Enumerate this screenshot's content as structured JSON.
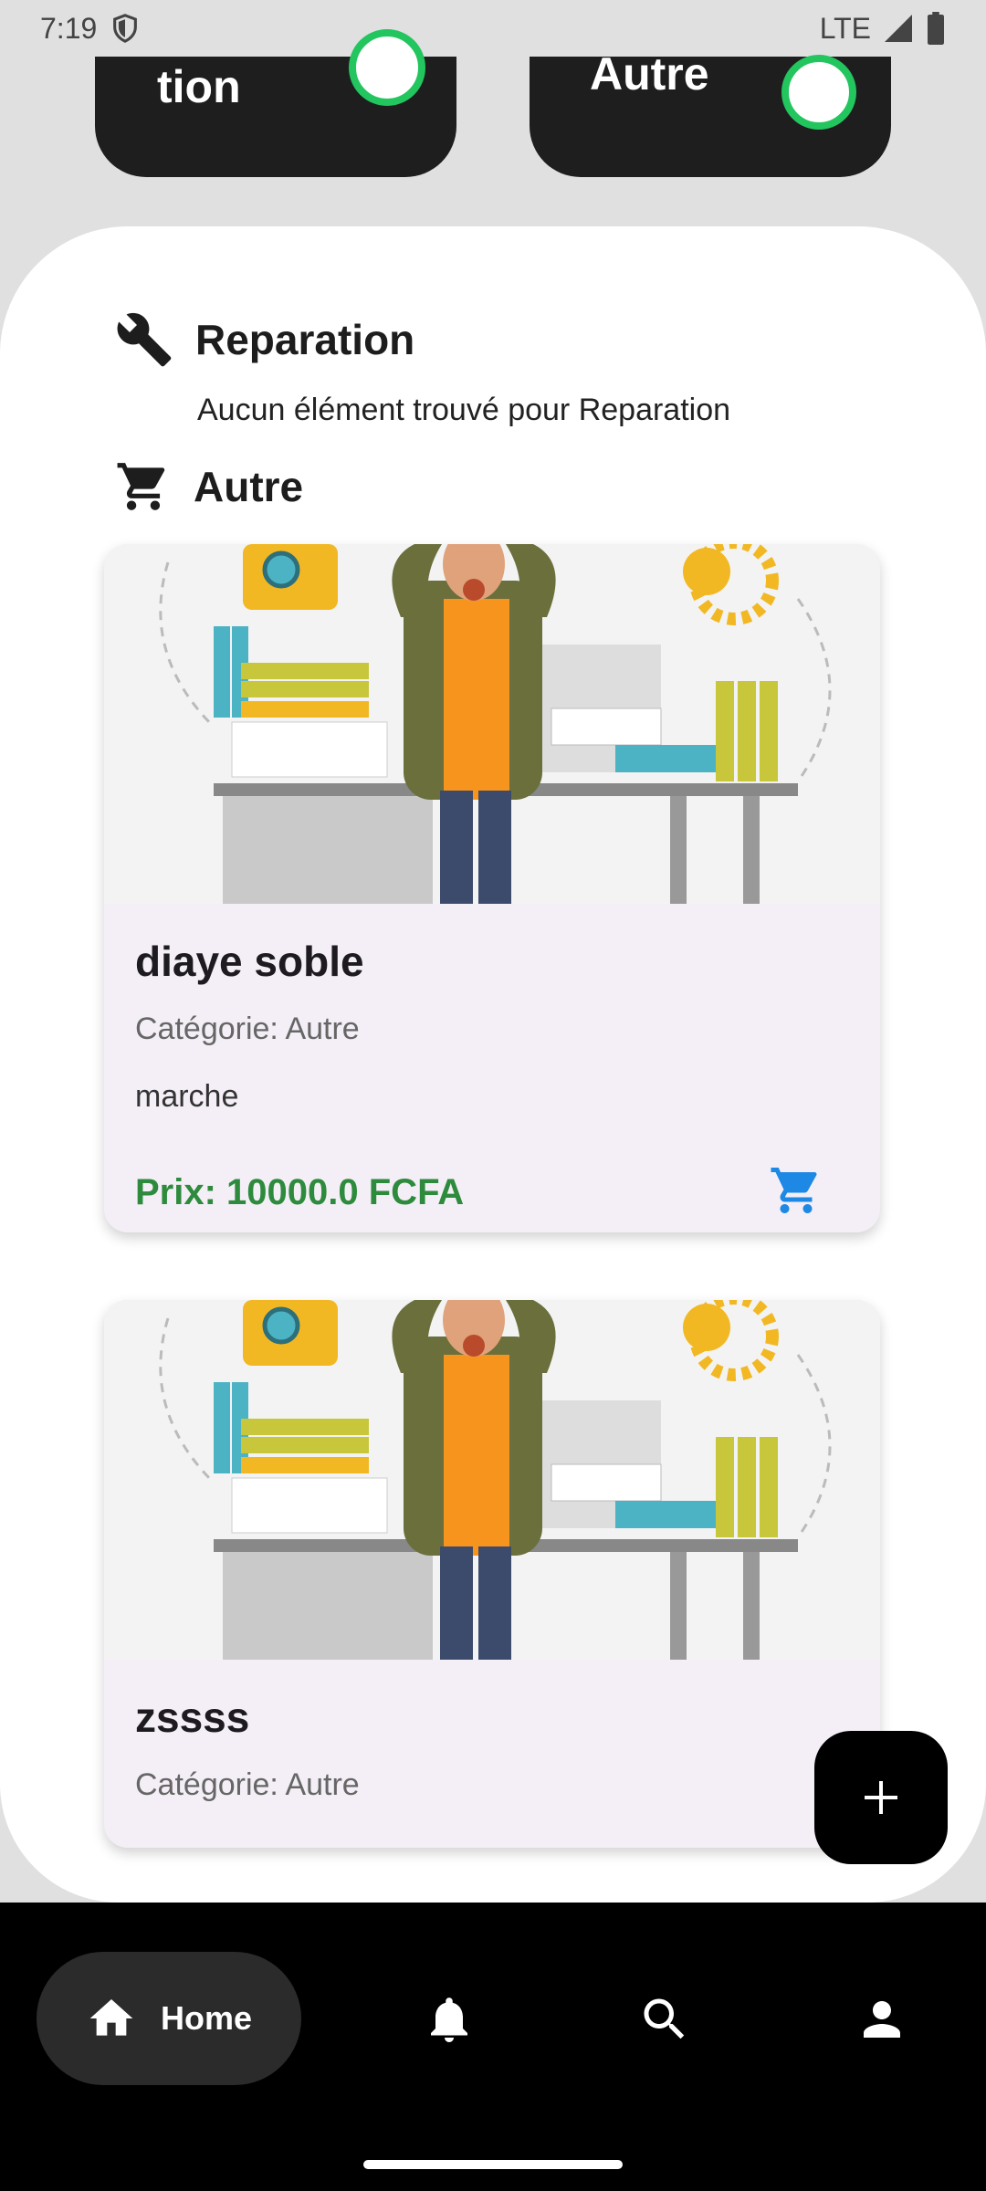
{
  "status_bar": {
    "time": "7:19",
    "network": "LTE"
  },
  "top_cards": [
    {
      "label": "tion",
      "toggle_on": true
    },
    {
      "label": "Autre",
      "toggle_on": true
    }
  ],
  "sections": {
    "reparation": {
      "title": "Reparation",
      "icon": "wrench-icon",
      "empty_message": "Aucun élément trouvé pour Reparation"
    },
    "autre": {
      "title": "Autre",
      "icon": "cart-icon"
    }
  },
  "products": [
    {
      "title": "diaye soble",
      "category": "Catégorie: Autre",
      "description": "marche",
      "price": "Prix: 10000.0 FCFA"
    },
    {
      "title": "zssss",
      "category": "Catégorie: Autre"
    }
  ],
  "fab": {
    "icon": "plus-icon"
  },
  "bottom_nav": {
    "home_label": "Home",
    "items": [
      "home-icon",
      "bell-icon",
      "search-icon",
      "person-icon"
    ]
  },
  "colors": {
    "accent_green": "#2e8b3d",
    "cart_blue": "#1e88e5",
    "toggle_green": "#22c55e"
  }
}
